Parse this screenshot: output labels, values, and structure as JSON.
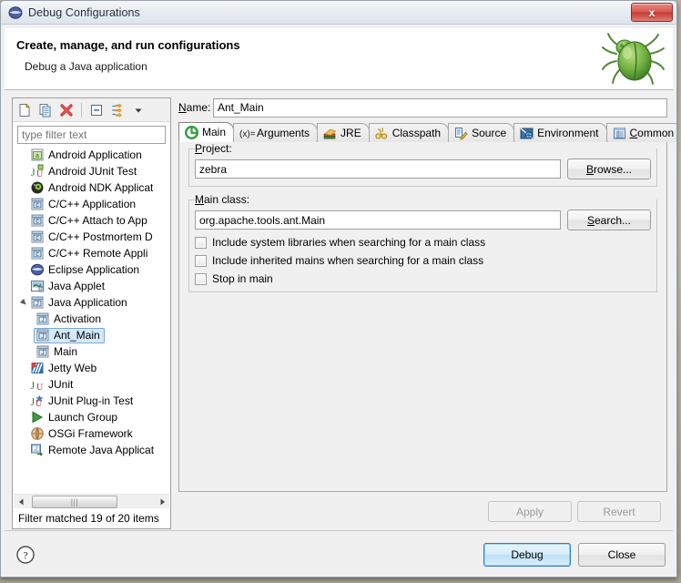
{
  "window": {
    "title": "Debug Configurations",
    "title_icon": "eclipse-debug-icon",
    "close_label": "x"
  },
  "header": {
    "title": "Create, manage, and run configurations",
    "subtitle": "Debug a Java application",
    "banner_icon": "green-bug-icon"
  },
  "tree_toolbar": {
    "buttons": [
      {
        "name": "new-launch-configuration-button",
        "icon": "new-document-icon"
      },
      {
        "name": "duplicate-launch-configuration-button",
        "icon": "copy-document-icon"
      },
      {
        "name": "delete-launch-configuration-button",
        "icon": "red-x-delete-icon"
      },
      {
        "name": "collapse-all-button",
        "icon": "collapse-all-icon"
      },
      {
        "name": "filter-launch-configurations-button",
        "icon": "filter-arrows-icon"
      },
      {
        "name": "view-menu-button",
        "icon": "chevron-down-icon"
      }
    ]
  },
  "filter": {
    "placeholder": "type filter text",
    "value": "",
    "status": "Filter matched 19 of 20 items"
  },
  "tree": {
    "items": [
      {
        "label": "Android Application",
        "icon": "android-app-icon",
        "depth": 0,
        "selected": false,
        "twisty": ""
      },
      {
        "label": "Android JUnit Test",
        "icon": "android-junit-icon",
        "depth": 0,
        "selected": false,
        "twisty": ""
      },
      {
        "label": "Android NDK Applicat",
        "icon": "android-ndk-icon",
        "depth": 0,
        "selected": false,
        "twisty": ""
      },
      {
        "label": "C/C++ Application",
        "icon": "cpp-app-icon",
        "depth": 0,
        "selected": false,
        "twisty": ""
      },
      {
        "label": "C/C++ Attach to App",
        "icon": "cpp-app-icon",
        "depth": 0,
        "selected": false,
        "twisty": ""
      },
      {
        "label": "C/C++ Postmortem D",
        "icon": "cpp-app-icon",
        "depth": 0,
        "selected": false,
        "twisty": ""
      },
      {
        "label": "C/C++ Remote Appli",
        "icon": "cpp-app-icon",
        "depth": 0,
        "selected": false,
        "twisty": ""
      },
      {
        "label": "Eclipse Application",
        "icon": "eclipse-app-icon",
        "depth": 0,
        "selected": false,
        "twisty": ""
      },
      {
        "label": "Java Applet",
        "icon": "java-applet-icon",
        "depth": 0,
        "selected": false,
        "twisty": ""
      },
      {
        "label": "Java Application",
        "icon": "java-app-icon",
        "depth": 0,
        "selected": false,
        "twisty": "expanded"
      },
      {
        "label": "Activation",
        "icon": "java-launch-icon",
        "depth": 1,
        "selected": false,
        "twisty": ""
      },
      {
        "label": "Ant_Main",
        "icon": "java-launch-icon",
        "depth": 1,
        "selected": true,
        "twisty": ""
      },
      {
        "label": "Main",
        "icon": "java-launch-icon",
        "depth": 1,
        "selected": false,
        "twisty": ""
      },
      {
        "label": "Jetty Web",
        "icon": "jetty-web-icon",
        "depth": 0,
        "selected": false,
        "twisty": ""
      },
      {
        "label": "JUnit",
        "icon": "junit-icon",
        "depth": 0,
        "selected": false,
        "twisty": ""
      },
      {
        "label": "JUnit Plug-in Test",
        "icon": "junit-plugin-icon",
        "depth": 0,
        "selected": false,
        "twisty": ""
      },
      {
        "label": "Launch Group",
        "icon": "launch-group-icon",
        "depth": 0,
        "selected": false,
        "twisty": ""
      },
      {
        "label": "OSGi Framework",
        "icon": "osgi-framework-icon",
        "depth": 0,
        "selected": false,
        "twisty": ""
      },
      {
        "label": "Remote Java Applicat",
        "icon": "remote-java-app-icon",
        "depth": 0,
        "selected": false,
        "twisty": ""
      }
    ]
  },
  "config": {
    "name_label": "Name:",
    "name_value": "Ant_Main"
  },
  "tabs": [
    {
      "label": "Main",
      "icon": "green-circle-arrow-icon",
      "active": true
    },
    {
      "label": "Arguments",
      "icon": "variables-xequals-icon",
      "active": false
    },
    {
      "label": "JRE",
      "icon": "jre-books-icon",
      "active": false
    },
    {
      "label": "Classpath",
      "icon": "classpath-links-icon",
      "active": false
    },
    {
      "label": "Source",
      "icon": "source-pencil-icon",
      "active": false
    },
    {
      "label": "Environment",
      "icon": "environment-icon",
      "active": false
    },
    {
      "label": "Common",
      "icon": "common-table-icon",
      "active": false
    }
  ],
  "main_tab": {
    "project_group_label": "Project:",
    "project_value": "zebra",
    "browse_label": "Browse...",
    "mainclass_group_label": "Main class:",
    "mainclass_value": "org.apache.tools.ant.Main",
    "search_label": "Search...",
    "checkboxes": [
      {
        "label": "Include system libraries when searching for a main class",
        "checked": false
      },
      {
        "label": "Include inherited mains when searching for a main class",
        "checked": false
      },
      {
        "label": "Stop in main",
        "checked": false
      }
    ],
    "apply_label": "Apply",
    "apply_enabled": false,
    "revert_label": "Revert",
    "revert_enabled": false
  },
  "footer": {
    "help_icon": "question-mark-help-icon",
    "debug_label": "Debug",
    "close_label": "Close"
  },
  "colors": {
    "accent_blue": "#2b7cc4",
    "selection_fill": "#d4e9fb",
    "selection_border": "#7ea7d0",
    "close_red": "#c33a31",
    "bug_green": "#5aa832",
    "dialog_bg": "#f0f0f0"
  }
}
